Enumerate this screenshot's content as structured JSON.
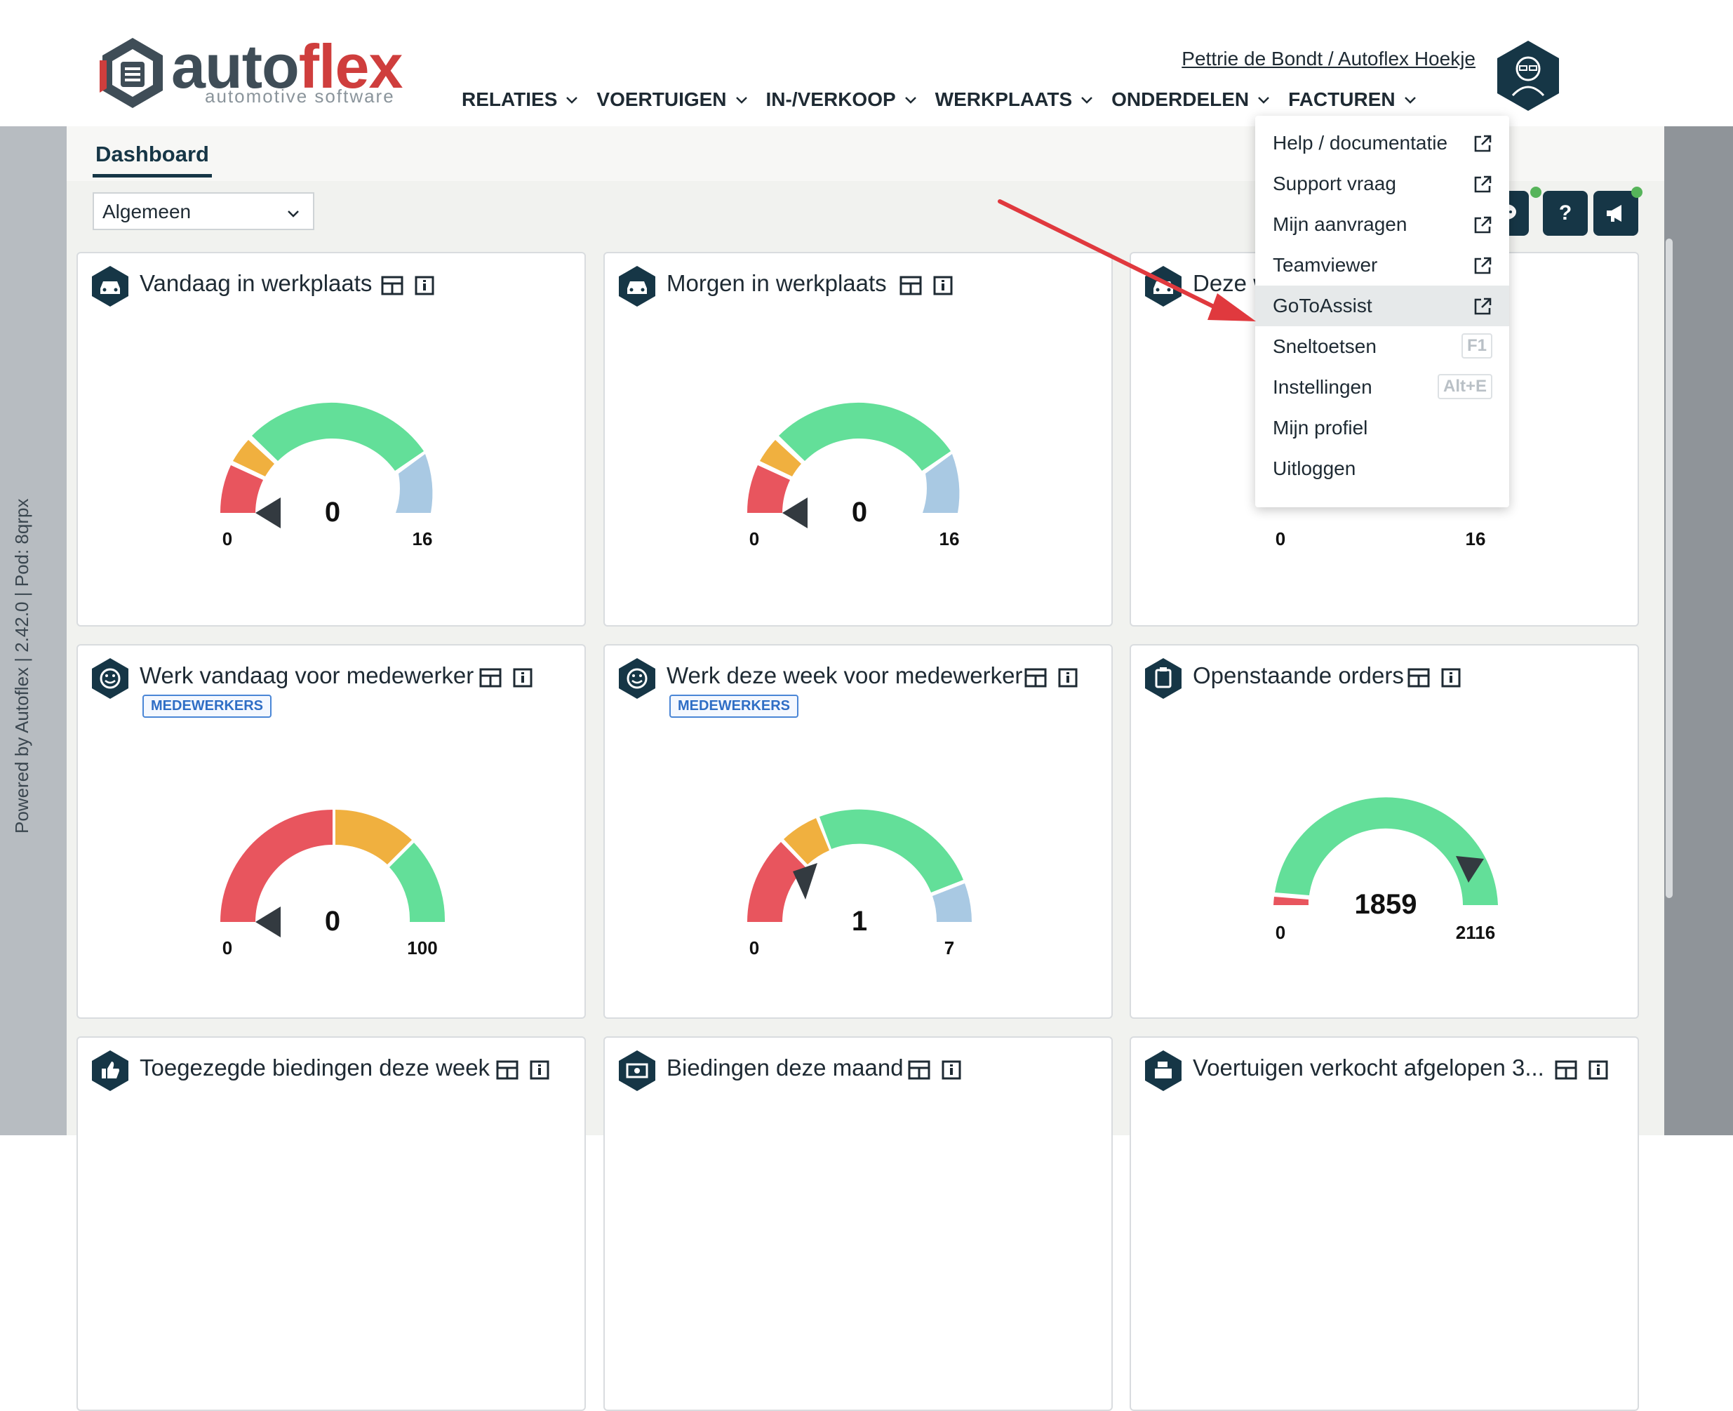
{
  "header": {
    "logo_word_a": "auto",
    "logo_word_b": "flex",
    "logo_tagline": "automotive software",
    "user_link": "Pettrie de Bondt / Autoflex Hoekje",
    "nav": [
      {
        "label": "RELATIES"
      },
      {
        "label": "VOERTUIGEN"
      },
      {
        "label": "IN-/VERKOOP"
      },
      {
        "label": "WERKPLAATS"
      },
      {
        "label": "ONDERDELEN"
      },
      {
        "label": "FACTUREN"
      }
    ]
  },
  "sidebar_text": "Powered by Autoflex | 2.42.0 | Pod: 8qrpx",
  "tabs": {
    "dashboard": "Dashboard"
  },
  "filter": {
    "selected": "Algemeen"
  },
  "toolbar": {
    "help_label": "?"
  },
  "cards": [
    {
      "title": "Vandaag in werkplaats",
      "value": "0",
      "min": "0",
      "max": "16"
    },
    {
      "title": "Morgen in werkplaats",
      "value": "0",
      "min": "0",
      "max": "16"
    },
    {
      "title": "Deze w",
      "min": "0",
      "max": "16"
    },
    {
      "title": "Werk vandaag voor medewerker",
      "badge": "MEDEWERKERS",
      "value": "0",
      "min": "0",
      "max": "100"
    },
    {
      "title": "Werk deze week voor medewerker",
      "badge": "MEDEWERKERS",
      "value": "1",
      "min": "0",
      "max": "7"
    },
    {
      "title": "Openstaande orders",
      "value": "1859",
      "min": "0",
      "max": "2116"
    },
    {
      "title": "Toegezegde biedingen deze week"
    },
    {
      "title": "Biedingen deze maand"
    },
    {
      "title": "Voertuigen verkocht afgelopen 3..."
    }
  ],
  "menu": [
    {
      "label": "Help / documentatie",
      "icon": "external-link-icon"
    },
    {
      "label": "Support vraag",
      "icon": "external-link-icon"
    },
    {
      "label": "Mijn aanvragen",
      "icon": "external-link-icon"
    },
    {
      "label": "Teamviewer",
      "icon": "external-link-icon"
    },
    {
      "label": "GoToAssist",
      "icon": "external-link-icon"
    },
    {
      "label": "Sneltoetsen",
      "shortcut": "F1"
    },
    {
      "label": "Instellingen",
      "shortcut": "Alt+E"
    },
    {
      "label": "Mijn profiel"
    },
    {
      "label": "Uitloggen"
    }
  ],
  "colors": {
    "primary": "#163646",
    "red": "#e8555e",
    "orange": "#f0b03f",
    "green": "#63df99",
    "light_blue": "#a9c9e3",
    "arrow": "#e0393e"
  }
}
